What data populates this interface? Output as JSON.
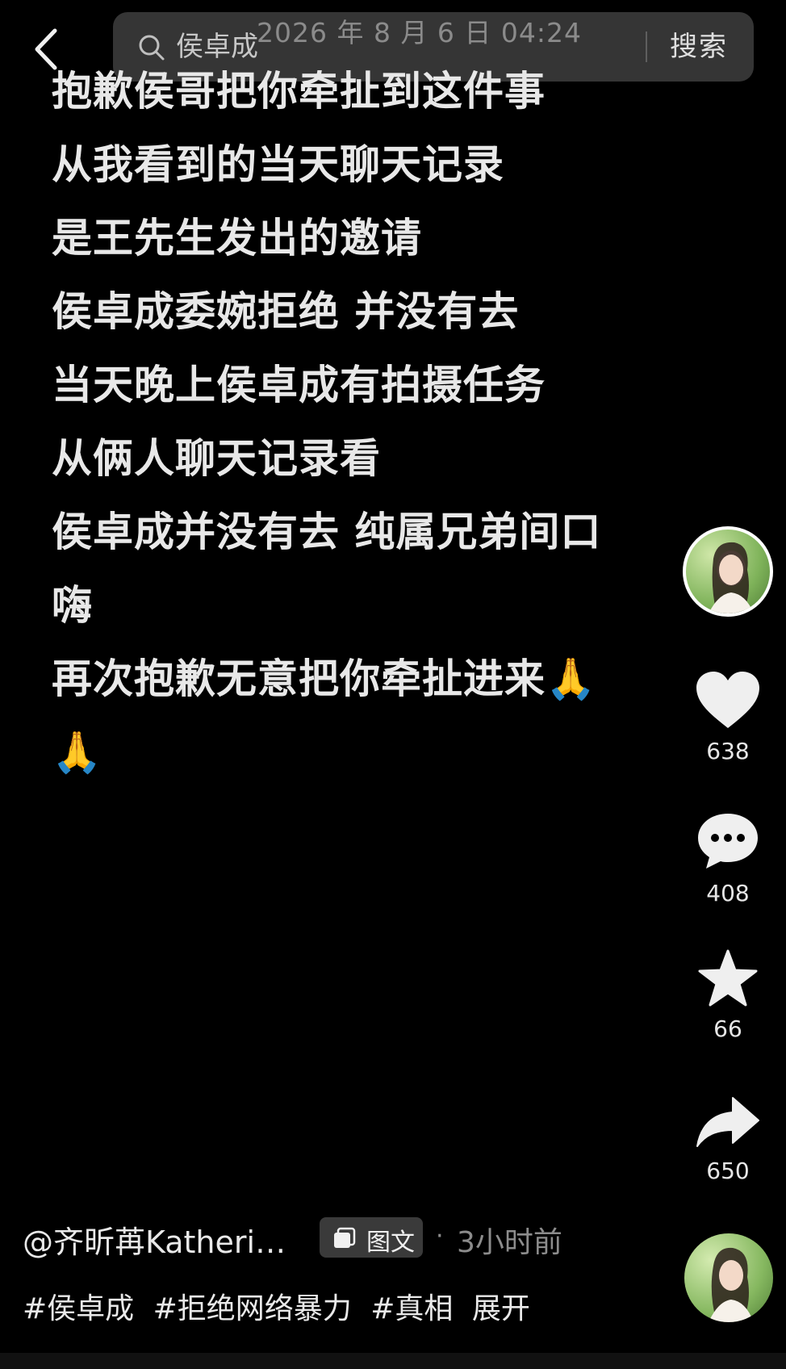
{
  "search": {
    "query": "侯卓成",
    "button_label": "搜索"
  },
  "watermark": "2026 年 8 月 6 日  04:24",
  "post": {
    "lines": [
      "抱歉侯哥把你牵扯到这件事",
      "从我看到的当天聊天记录",
      "是王先生发出的邀请",
      "侯卓成委婉拒绝 并没有去",
      "当天晚上侯卓成有拍摄任务",
      "从俩人聊天记录看",
      "侯卓成并没有去 纯属兄弟间口",
      "嗨",
      "再次抱歉无意把你牵扯进来🙏",
      "🙏"
    ]
  },
  "rail": {
    "like_count": "638",
    "comment_count": "408",
    "favorite_count": "66",
    "share_count": "650"
  },
  "footer": {
    "author": "@齐昕苒Katheri…",
    "type_badge": "图文",
    "dot": "·",
    "time": "3小时前",
    "tags": [
      "#侯卓成",
      "#拒绝网络暴力",
      "#真相",
      "展开"
    ]
  },
  "icons": {
    "back": "chevron-left-icon",
    "search": "search-icon",
    "like": "heart-icon",
    "comment": "comment-icon",
    "favorite": "star-icon",
    "share": "share-icon",
    "badge": "image-text-icon"
  },
  "colors": {
    "background": "#000000",
    "text": "#e8e8e8",
    "muted": "#8c8c8c",
    "searchbar": "#3a3a3a"
  }
}
